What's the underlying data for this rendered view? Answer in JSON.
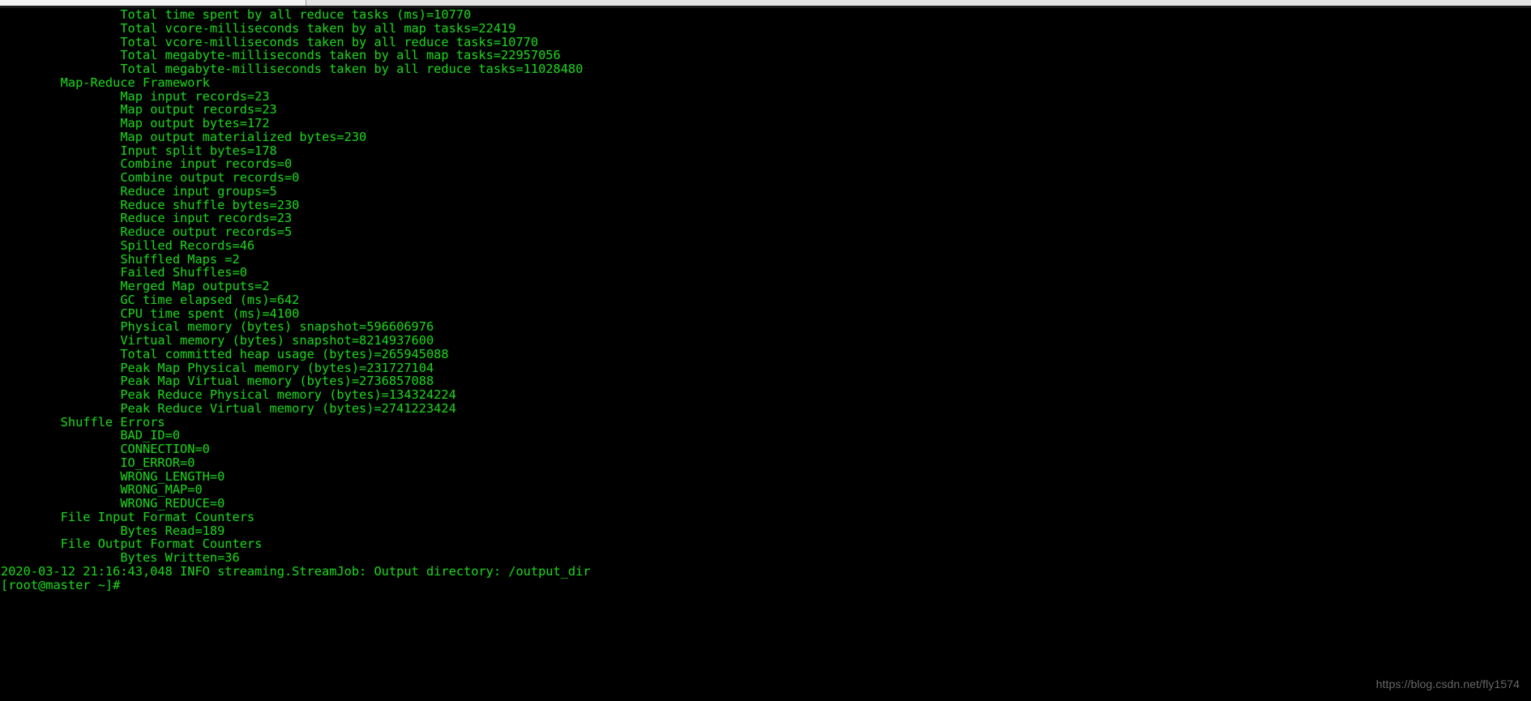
{
  "window": {
    "chrome_visible": true
  },
  "terminal": {
    "background_color": "#000000",
    "foreground_color": "#1ecb1e",
    "lines": [
      "                Total time spent by all reduce tasks (ms)=10770",
      "                Total vcore-milliseconds taken by all map tasks=22419",
      "                Total vcore-milliseconds taken by all reduce tasks=10770",
      "                Total megabyte-milliseconds taken by all map tasks=22957056",
      "                Total megabyte-milliseconds taken by all reduce tasks=11028480",
      "        Map-Reduce Framework",
      "                Map input records=23",
      "                Map output records=23",
      "                Map output bytes=172",
      "                Map output materialized bytes=230",
      "                Input split bytes=178",
      "                Combine input records=0",
      "                Combine output records=0",
      "                Reduce input groups=5",
      "                Reduce shuffle bytes=230",
      "                Reduce input records=23",
      "                Reduce output records=5",
      "                Spilled Records=46",
      "                Shuffled Maps =2",
      "                Failed Shuffles=0",
      "                Merged Map outputs=2",
      "                GC time elapsed (ms)=642",
      "                CPU time spent (ms)=4100",
      "                Physical memory (bytes) snapshot=596606976",
      "                Virtual memory (bytes) snapshot=8214937600",
      "                Total committed heap usage (bytes)=265945088",
      "                Peak Map Physical memory (bytes)=231727104",
      "                Peak Map Virtual memory (bytes)=2736857088",
      "                Peak Reduce Physical memory (bytes)=134324224",
      "                Peak Reduce Virtual memory (bytes)=2741223424",
      "        Shuffle Errors",
      "                BAD_ID=0",
      "                CONNECTION=0",
      "                IO_ERROR=0",
      "                WRONG_LENGTH=0",
      "                WRONG_MAP=0",
      "                WRONG_REDUCE=0",
      "        File Input Format Counters",
      "                Bytes Read=189",
      "        File Output Format Counters",
      "                Bytes Written=36",
      "2020-03-12 21:16:43,048 INFO streaming.StreamJob: Output directory: /output_dir"
    ],
    "prompt": "[root@master ~]#"
  },
  "watermark": {
    "text": "https://blog.csdn.net/fly1574"
  }
}
